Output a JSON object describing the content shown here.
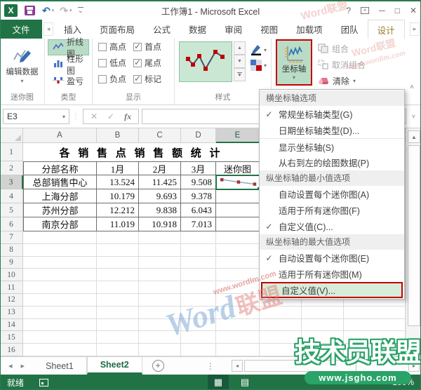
{
  "window": {
    "title": "工作簿1 - Microsoft Excel"
  },
  "tab_bar": {
    "file": "文件",
    "tabs": [
      "插入",
      "页面布局",
      "公式",
      "数据",
      "审阅",
      "视图",
      "加载项",
      "团队",
      "设计"
    ],
    "active_tab": "设计"
  },
  "ribbon": {
    "group_labels": {
      "sparkline": "迷你图",
      "type": "类型",
      "show": "显示",
      "style": "样式"
    },
    "edit_data_label": "编辑数据",
    "type_buttons": [
      {
        "label": "折线图",
        "selected": true
      },
      {
        "label": "柱形图",
        "selected": false
      },
      {
        "label": "盈亏",
        "selected": false
      }
    ],
    "show_options": [
      {
        "label": "高点",
        "checked": false
      },
      {
        "label": "低点",
        "checked": false
      },
      {
        "label": "负点",
        "checked": false
      },
      {
        "label": "首点",
        "checked": true
      },
      {
        "label": "尾点",
        "checked": true
      },
      {
        "label": "标记",
        "checked": true
      }
    ],
    "axis_button_label": "坐标轴",
    "group_label": "组合",
    "ungroup_label": "取消组合",
    "clear_label": "清除"
  },
  "formula_bar": {
    "name_box": "E3",
    "fx_label": "fx",
    "formula_value": ""
  },
  "axis_menu": {
    "items": [
      {
        "type": "header",
        "label": "横坐标轴选项"
      },
      {
        "type": "item",
        "label": "常规坐标轴类型(G)",
        "checked": true
      },
      {
        "type": "item",
        "label": "日期坐标轴类型(D)...",
        "checked": false
      },
      {
        "type": "item",
        "label": "显示坐标轴(S)",
        "checked": false,
        "separator_before": true
      },
      {
        "type": "item",
        "label": "从右到左的绘图数据(P)",
        "checked": false
      },
      {
        "type": "header",
        "label": "纵坐标轴的最小值选项"
      },
      {
        "type": "item",
        "label": "自动设置每个迷你图(A)",
        "checked": false
      },
      {
        "type": "item",
        "label": "适用于所有迷你图(F)",
        "checked": false
      },
      {
        "type": "item",
        "label": "自定义值(C)...",
        "checked": true
      },
      {
        "type": "header",
        "label": "纵坐标轴的最大值选项"
      },
      {
        "type": "item",
        "label": "自动设置每个迷你图(E)",
        "checked": true
      },
      {
        "type": "item",
        "label": "适用于所有迷你图(M)",
        "checked": false
      },
      {
        "type": "item",
        "label": "自定义值(V)...",
        "checked": false,
        "highlighted": true
      }
    ]
  },
  "sheet": {
    "col_headers": [
      "A",
      "B",
      "C",
      "D",
      "E"
    ],
    "selected_col": "E",
    "selected_row": 3,
    "rows_visible": 16,
    "title": "各 销 售 点 销 售 额 统 计",
    "table_headers": [
      "分部名称",
      "1月",
      "2月",
      "3月",
      "迷你图"
    ],
    "table_rows": [
      [
        "总部销售中心",
        "13.524",
        "11.425",
        "9.508"
      ],
      [
        "上海分部",
        "10.179",
        "9.693",
        "9.378"
      ],
      [
        "苏州分部",
        "12.212",
        "9.838",
        "6.043"
      ],
      [
        "南京分部",
        "11.019",
        "10.918",
        "7.013"
      ]
    ],
    "sparkline": {
      "cell": "E3",
      "values": [
        13.524,
        11.425,
        9.508
      ]
    }
  },
  "sheet_tabs": {
    "tabs": [
      {
        "label": "Sheet1",
        "active": false
      },
      {
        "label": "Sheet2",
        "active": true
      }
    ]
  },
  "status_bar": {
    "mode": "就绪",
    "zoom": "100%"
  },
  "watermarks": {
    "wordlm_url": "www.wordlm.com",
    "wordlm_word": "Word",
    "wordlm_league": "联盟",
    "stamp": "Word联盟",
    "tech_big": "技术员联盟",
    "tech_url": "www.jsgho.com"
  },
  "colors": {
    "excel_green": "#217346",
    "highlight_green": "#b9dcc6",
    "annotation_red": "#c40000",
    "marker_red": "#9c3a38"
  }
}
